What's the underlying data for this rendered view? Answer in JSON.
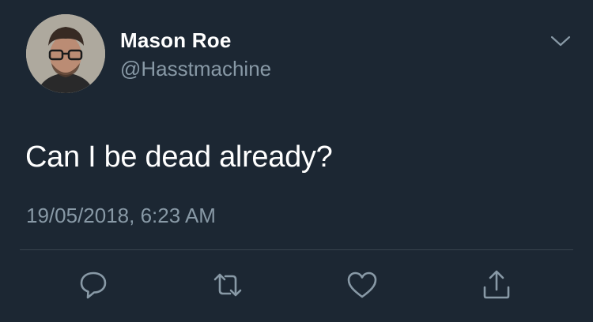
{
  "tweet": {
    "display_name": "Mason Roe",
    "handle": "@Hasstmachine",
    "text": "Can I be dead already?",
    "timestamp": "19/05/2018, 6:23 AM"
  },
  "icons": {
    "menu": "chevron-down-icon",
    "reply": "reply-icon",
    "retweet": "retweet-icon",
    "like": "heart-icon",
    "share": "share-icon"
  },
  "colors": {
    "background": "#1c2733",
    "primary_text": "#ffffff",
    "secondary_text": "#8899a6",
    "divider": "#38444d"
  }
}
